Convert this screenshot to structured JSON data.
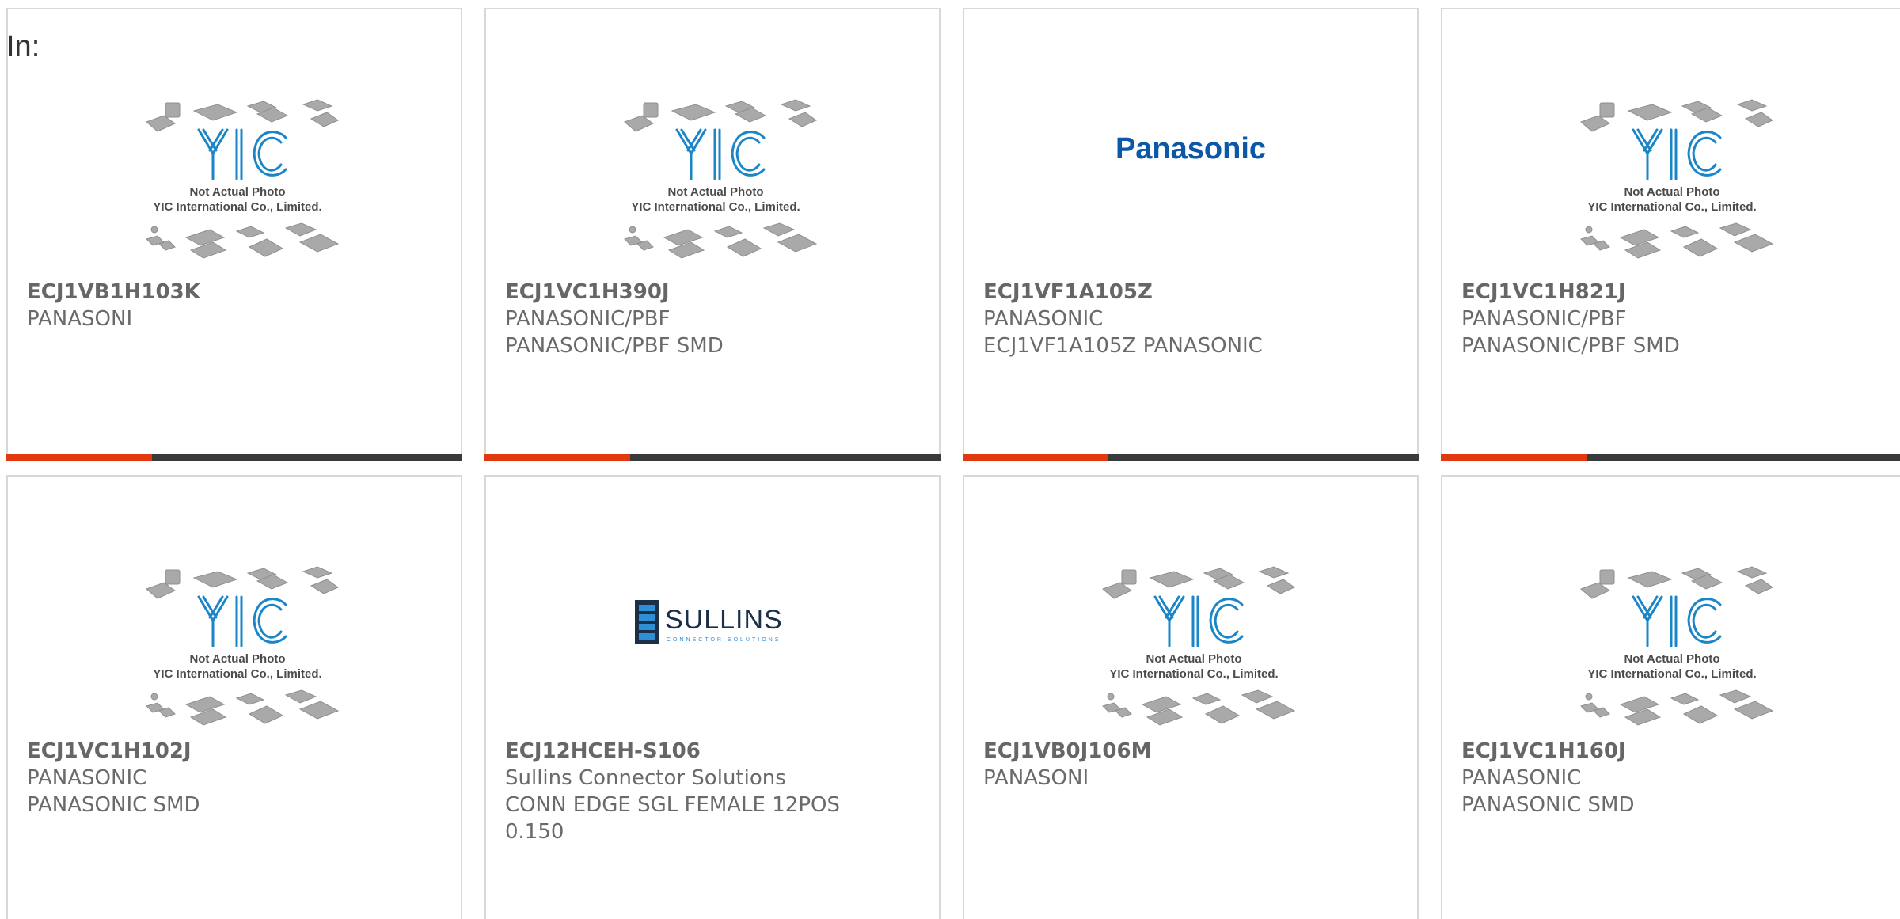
{
  "filter": {
    "label": "In:"
  },
  "placeholder_image": {
    "line1": "Not Actual Photo",
    "line2": "YIC International Co., Limited.",
    "logo_text": "YIC"
  },
  "brands": {
    "panasonic": "Panasonic",
    "sullins": "SULLINS",
    "sullins_tag": "CONNECTOR SOLUTIONS"
  },
  "products": [
    {
      "part": "ECJ1VB1H103K",
      "line1": "PANASONI",
      "line2": "",
      "line3": "",
      "image": "yic-placeholder"
    },
    {
      "part": "ECJ1VC1H390J",
      "line1": "PANASONIC/PBF",
      "line2": "PANASONIC/PBF SMD",
      "line3": "",
      "image": "yic-placeholder"
    },
    {
      "part": "ECJ1VF1A105Z",
      "line1": "PANASONIC",
      "line2": "ECJ1VF1A105Z PANASONIC",
      "line3": "",
      "image": "panasonic-logo"
    },
    {
      "part": "ECJ1VC1H821J",
      "line1": "PANASONIC/PBF",
      "line2": "PANASONIC/PBF SMD",
      "line3": "",
      "image": "yic-placeholder"
    },
    {
      "part": "ECJ1VC1H102J",
      "line1": "PANASONIC",
      "line2": "PANASONIC SMD",
      "line3": "",
      "image": "yic-placeholder"
    },
    {
      "part": "ECJ12HCEH-S106",
      "line1": "Sullins Connector Solutions",
      "line2": "CONN EDGE SGL FEMALE 12POS",
      "line3": "0.150",
      "image": "sullins-logo"
    },
    {
      "part": "ECJ1VB0J106M",
      "line1": "PANASONI",
      "line2": "",
      "line3": "",
      "image": "yic-placeholder"
    },
    {
      "part": "ECJ1VC1H160J",
      "line1": "PANASONIC",
      "line2": "PANASONIC SMD",
      "line3": "",
      "image": "yic-placeholder"
    }
  ],
  "colors": {
    "accent": "#e2380f",
    "bar_dark": "#3a3a3a",
    "yic_blue": "#1a86c8",
    "panasonic_blue": "#0b58a8"
  }
}
